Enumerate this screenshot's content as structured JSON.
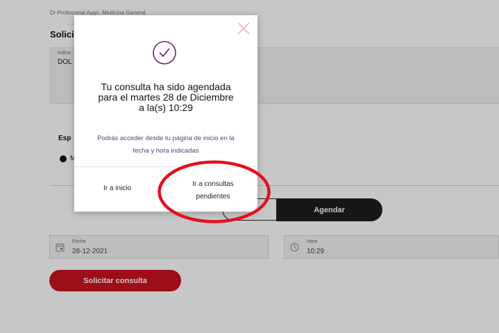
{
  "page": {
    "doctor_line": "Dr Profesional Aygn. Medicina General",
    "section_title": "Solici",
    "indications": {
      "label": "Indica",
      "value": "DOL"
    },
    "specialty": {
      "label": "Esp",
      "radio_label": "M"
    },
    "schedule_button": "Agendar",
    "date_field": {
      "label": "Fecha",
      "value": "28-12-2021"
    },
    "time_field": {
      "label": "Hora",
      "value": "10:29"
    },
    "submit_button": "Solicitar consulta"
  },
  "modal": {
    "title_line1": "Tu consulta ha sido agendada",
    "title_line2": "para el martes 28 de Diciembre",
    "title_line3": "a la(s) 10:29",
    "desc_line1": "Podrás acceder desde tu página de inicio en la",
    "desc_line2": "fecha y hora indicadas",
    "go_home": "Ir a inicio",
    "go_pending_line1": "Ir a consultas",
    "go_pending_line2": "pendientes",
    "close_icon": "close-icon",
    "success_icon": "check-circle-icon"
  },
  "colors": {
    "accent_red": "#c9121d",
    "annotation_red": "#e3101c",
    "modal_icon": "#6b1f6a",
    "close_icon": "#e5a6cf",
    "dark_button": "#1e1e1e"
  }
}
